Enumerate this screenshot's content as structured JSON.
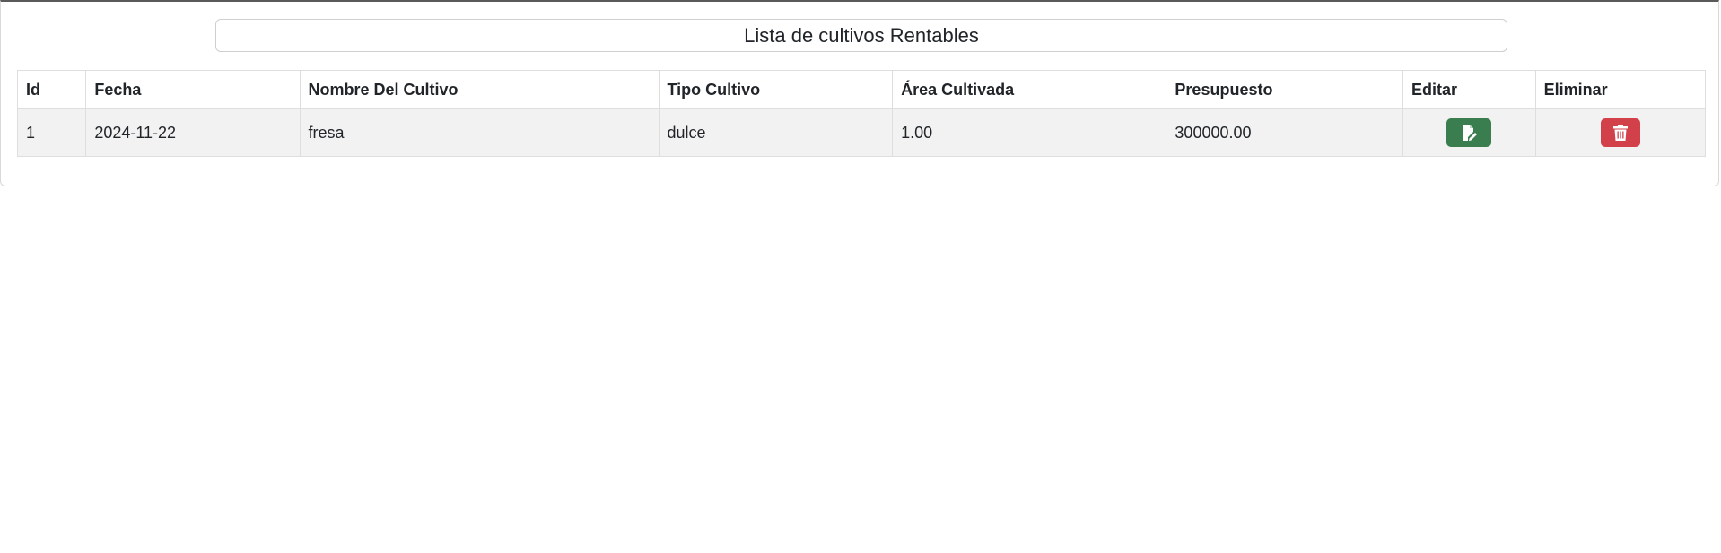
{
  "page": {
    "title": "Lista de cultivos Rentables"
  },
  "table": {
    "headers": {
      "id": "Id",
      "fecha": "Fecha",
      "nombre": "Nombre Del Cultivo",
      "tipo": "Tipo Cultivo",
      "area": "Área Cultivada",
      "presupuesto": "Presupuesto",
      "editar": "Editar",
      "eliminar": "Eliminar"
    },
    "rows": [
      {
        "id": "1",
        "fecha": "2024-11-22",
        "nombre": "fresa",
        "tipo": "dulce",
        "area": "1.00",
        "presupuesto": "300000.00",
        "edit_icon": "file-edit-icon",
        "delete_icon": "trash-icon"
      }
    ]
  },
  "colors": {
    "edit_button": "#3a7d4f",
    "delete_button": "#d2404a",
    "row_background": "#f2f2f2"
  }
}
